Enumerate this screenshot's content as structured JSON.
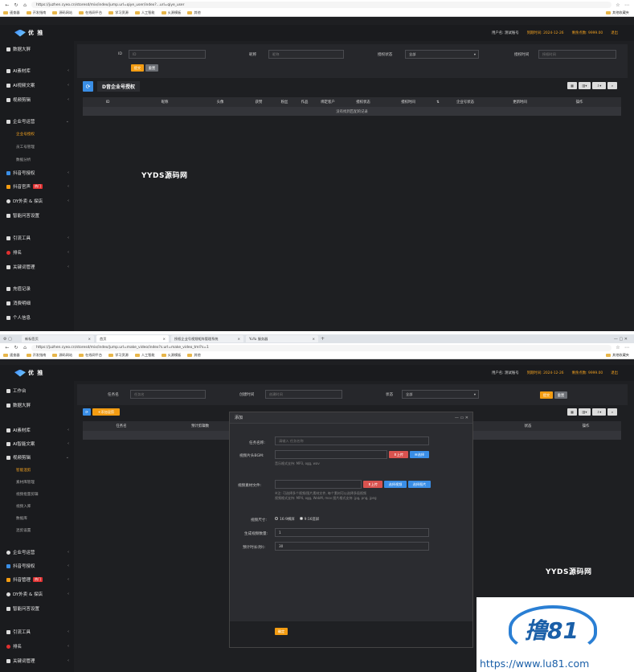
{
  "screen1": {
    "url": "https://juzhen.cyeo.cn/storesd/mix/index/jump.url=qiye_user/index?...url=qiye_user",
    "bookmarks": [
      "速查器",
      "开发指南",
      "源码网站",
      "在线网平台",
      "学习资源",
      "人工智能",
      "火源模板",
      "其他"
    ],
    "bookmark_right": "其他收藏夹",
    "logo": "优 推",
    "top_user": "用户名: 测试账号",
    "top_expiry": "到期时间: 2024-12-26",
    "top_points": "剩余点数: 9999.00",
    "top_logout": "退出",
    "sidebar": {
      "top": "数据大屏",
      "items": [
        "AI素材库",
        "AI视频文案",
        "视频剪辑",
        "企业号运营",
        "抖音号授权",
        "抖音官声",
        "DY外卖 & 探店",
        "智能问答设置",
        "引流工具",
        "排名",
        "关键词管理",
        "充值记录",
        "消费明细",
        "个人信息"
      ],
      "enterprise_subs": [
        "企业号授权",
        "员工号管理",
        "数据分析"
      ],
      "hot_badge": "热门"
    },
    "filters": {
      "id_label": "ID",
      "id_placeholder": "ID",
      "nick_label": "昵称",
      "nick_placeholder": "昵称",
      "status_label": "授权状态",
      "status_value": "全部",
      "time_label": "授权时间",
      "time_placeholder": "授权时间",
      "submit": "提交",
      "reset": "重置"
    },
    "table_title": "D音企业号授权",
    "columns": [
      "ID",
      "昵称",
      "头像",
      "获赞",
      "粉丝",
      "作品",
      "绑定客户",
      "授权状态",
      "授权时间",
      "",
      "企业号状态",
      "更新时间",
      "操作"
    ],
    "empty": "没有找到匹配的记录",
    "watermark": "YYDS源码网"
  },
  "screen2": {
    "tabs": [
      "新标签页",
      "首页",
      "授权企业号视频矩阵管理系统",
      "YuYu 服务器"
    ],
    "url": "https://juzhen.cyeo.cn/storesd/mix/index/jump.url=make_video/index?s.url=make_video_tml?s=1",
    "bookmarks": [
      "速查器",
      "开发指南",
      "源码网站",
      "在线网平台",
      "学习资源",
      "人工智能",
      "火源模板",
      "其他"
    ],
    "bookmark_right": "其他收藏夹",
    "logo": "优 推",
    "top_user": "用户名: 测试账号",
    "top_expiry": "到期时间: 2024-12-26",
    "top_points": "剩余点数: 9999.00",
    "top_logout": "退出",
    "sidebar": {
      "items_top": [
        "工作台",
        "数据大屏"
      ],
      "items": [
        "AI素材库",
        "AI智能文案",
        "视频剪辑",
        "企业号运营",
        "抖音号授权",
        "抖音管理",
        "DY外卖 & 探店",
        "智能问答设置",
        "引流工具",
        "排名",
        "关键词管理"
      ],
      "edit_subs": [
        "智能混剪",
        "素材库管理",
        "视频批量剪辑",
        "视频入库",
        "数据库",
        "混剪设置"
      ],
      "hot_badge": "热门"
    },
    "filters": {
      "task_label": "任务名",
      "task_placeholder": "任务名",
      "created_label": "创建时间",
      "created_placeholder": "创建时间",
      "status_label": "状态",
      "status_value": "全部",
      "submit": "提交",
      "reset": "重置"
    },
    "add_button": "添加混剪",
    "columns": [
      "任务名",
      "预计剪辑数",
      "状态",
      "操作"
    ],
    "modal": {
      "title": "添加",
      "task_label": "任务名称:",
      "task_placeholder": "请输入 任务名称",
      "video_label": "视频片头BGM:",
      "upload": "上传",
      "select": "选择",
      "video_hint": "音乐格式支持: MP3, ogg, wav",
      "clips_label": "视频素材文件:",
      "clip_upload": "上传",
      "clip_library": "选择视频",
      "clip_choose": "选择图片",
      "clips_hint1": "※注: 可选择多个视频/图片素材文件, 每个素材可以选择多段视频",
      "clips_hint2": "视频格式支持: MP4, ogg, WebM, mov 图片格式支持: jpg, png, jpeg",
      "size_label": "视频尺寸:",
      "size_opt1": "16:9横屏",
      "size_opt2": "9:16竖屏",
      "count_label": "生成视频数量:",
      "count_value": "1",
      "duration_label": "预计时长(秒):",
      "duration_value": "30",
      "confirm": "确定"
    },
    "watermark": "YYDS源码网",
    "lu81": "https://www.lu81.com",
    "lu81_logo": "撸81"
  }
}
